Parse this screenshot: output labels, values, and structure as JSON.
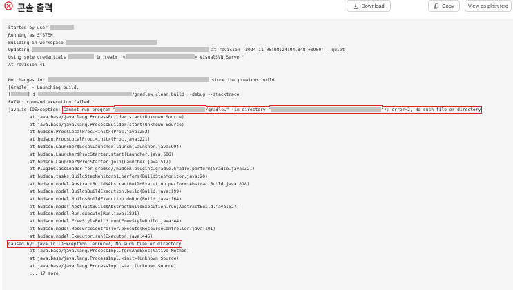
{
  "header": {
    "title": "콘솔 출력",
    "download_label": "Download",
    "copy_label": "Copy",
    "plain_text_label": "View as plain text"
  },
  "console": {
    "started_by": "Started by user ",
    "running_as": "Running as SYSTEM",
    "building_in": "Building in workspace ",
    "updating_prefix": "Updating ",
    "updating_suffix": " at revision '2024-11-05T08:24:04.848 +0900' --quiet",
    "credentials_prefix": "Using sole credentials ",
    "credentials_mid": " in realm '<",
    "credentials_suffix": "> VisualSVN Server'",
    "at_revision": "At revision 41",
    "no_changes_prefix": "No changes for ",
    "no_changes_suffix": " since the previous build",
    "gradle_launch": "[Gradle] - Launching build.",
    "cmd_open": "[",
    "cmd_mid": "] $ ",
    "cmd_suffix": "/gradlew clean build --debug --stacktrace",
    "fatal": "FATAL: command execution failed",
    "exception_prefix": "java.io.IOException: ",
    "exception_a": "Cannot run program \"",
    "exception_b": "/gradlew\" (in directory \"",
    "exception_c": "\"): error=2, No such file or directory",
    "stack": [
      "at java.base/java.lang.ProcessBuilder.start(Unknown Source)",
      "at java.base/java.lang.ProcessBuilder.start(Unknown Source)",
      "at hudson.Proc$LocalProc.<init>(Proc.java:252)",
      "at hudson.Proc$LocalProc.<init>(Proc.java:221)",
      "at hudson.Launcher$LocalLauncher.launch(Launcher.java:994)",
      "at hudson.Launcher$ProcStarter.start(Launcher.java:506)",
      "at hudson.Launcher$ProcStarter.join(Launcher.java:517)",
      "at PluginClassLoader for gradle//hudson.plugins.gradle.Gradle.perform(Gradle.java:321)",
      "at hudson.tasks.BuildStepMonitor$1.perform(BuildStepMonitor.java:20)",
      "at hudson.model.AbstractBuild$AbstractBuildExecution.perform(AbstractBuild.java:818)",
      "at hudson.model.Build$BuildExecution.build(Build.java:199)",
      "at hudson.model.Build$BuildExecution.doRun(Build.java:164)",
      "at hudson.model.AbstractBuild$AbstractBuildExecution.run(AbstractBuild.java:527)",
      "at hudson.model.Run.execute(Run.java:1831)",
      "at hudson.model.FreeStyleBuild.run(FreeStyleBuild.java:44)",
      "at hudson.model.ResourceController.execute(ResourceController.java:101)",
      "at hudson.model.Executor.run(Executor.java:445)"
    ],
    "caused_by": "Caused by: java.io.IOException: error=2, No such file or directory",
    "cause_stack": [
      "at java.base/java.lang.ProcessImpl.forkAndExec(Native Method)",
      "at java.base/java.lang.ProcessImpl.<init>(Unknown Source)",
      "at java.base/java.lang.ProcessImpl.start(Unknown Source)",
      "... 17 more"
    ]
  },
  "colors": {
    "fail_red": "#d8262d",
    "console_bg": "#f5f5f5",
    "redaction": "#c4c4c4"
  }
}
